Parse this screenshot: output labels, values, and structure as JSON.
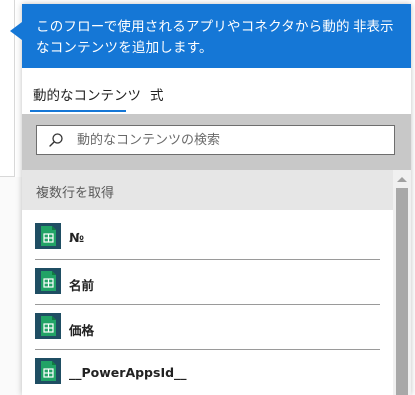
{
  "banner": {
    "text": "このフローで使用されるアプリやコネクタから動的なコンテンツを追加します。",
    "hide_label": "非表示",
    "color": "#1577d6"
  },
  "tabs": [
    {
      "label": "動的なコンテンツ",
      "selected": true
    },
    {
      "label": "式",
      "selected": false
    }
  ],
  "search": {
    "placeholder": "動的なコンテンツの検索",
    "value": "",
    "icon": "search-icon"
  },
  "section": {
    "label": "複数行を取得"
  },
  "items": [
    {
      "label": "№",
      "icon": "excel-table-icon"
    },
    {
      "label": "名前",
      "icon": "excel-table-icon"
    },
    {
      "label": "価格",
      "icon": "excel-table-icon"
    },
    {
      "label": "__PowerAppsId__",
      "icon": "excel-table-icon"
    }
  ],
  "colors": {
    "accent": "#1577d6",
    "icon_green": "#1e7145",
    "icon_dark": "#1f4e63"
  }
}
